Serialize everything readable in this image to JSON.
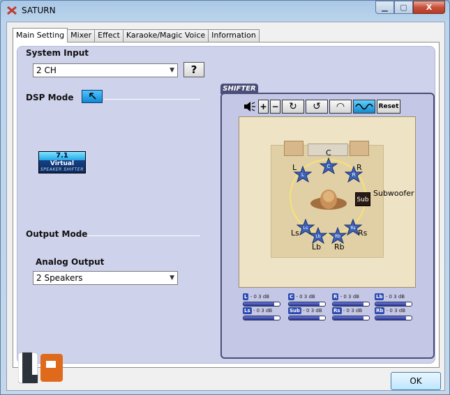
{
  "window": {
    "title": "SATURN",
    "close_label": "X"
  },
  "tabs": [
    {
      "label": "Main Setting"
    },
    {
      "label": "Mixer"
    },
    {
      "label": "Effect"
    },
    {
      "label": "Karaoke/Magic Voice"
    },
    {
      "label": "Information"
    }
  ],
  "system_input": {
    "label": "System Input",
    "value": "2 CH",
    "help_label": "?"
  },
  "dsp_mode": {
    "label": "DSP Mode"
  },
  "virtual_logo": {
    "top": "7.1",
    "mid": "Virtual",
    "bottom": "SPEAKER SHIFTER"
  },
  "output_mode": {
    "label": "Output Mode",
    "analog_label": "Analog Output",
    "value": "2 Speakers"
  },
  "shifter": {
    "tab_label": "SHIFTER",
    "reset_label": "Reset",
    "speakers": {
      "C": "C",
      "L": "L",
      "R": "R",
      "Ls": "Ls",
      "Rs": "Rs",
      "Lb": "Lb",
      "Rb": "Rb",
      "Sub": "Subwoofer",
      "sub_badge": "Sub"
    },
    "meters_row1": [
      {
        "name": "L",
        "value": "- 0 3 dB",
        "level": 0.85
      },
      {
        "name": "C",
        "value": "- 0 3 dB",
        "level": 0.85
      },
      {
        "name": "R",
        "value": "- 0 3 dB",
        "level": 0.85
      },
      {
        "name": "Lb",
        "value": "- 0 3 dB",
        "level": 0.85
      }
    ],
    "meters_row2": [
      {
        "name": "Ls",
        "value": "- 0 3 dB",
        "level": 0.85
      },
      {
        "name": "Sub",
        "value": "- 0 3 dB",
        "level": 0.85
      },
      {
        "name": "Rs",
        "value": "- 0 3 dB",
        "level": 0.85
      },
      {
        "name": "Rb",
        "value": "- 0 3 dB",
        "level": 0.85
      }
    ]
  },
  "ok_label": "OK",
  "colors": {
    "accent": "#1088d0",
    "panel": "#cfd2eb",
    "meter_fill": "#26348e"
  }
}
